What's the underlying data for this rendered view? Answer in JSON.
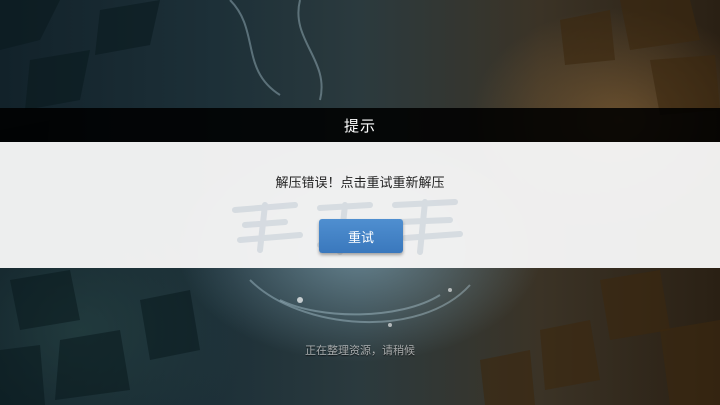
{
  "dialog": {
    "title": "提示",
    "message": "解压错误！点击重试重新解压",
    "retry_label": "重试"
  },
  "status": {
    "text": "正在整理资源，请稍候"
  },
  "colors": {
    "header_bg": "#000000",
    "body_bg": "#f5f5f5",
    "button_bg": "#4586c8"
  }
}
